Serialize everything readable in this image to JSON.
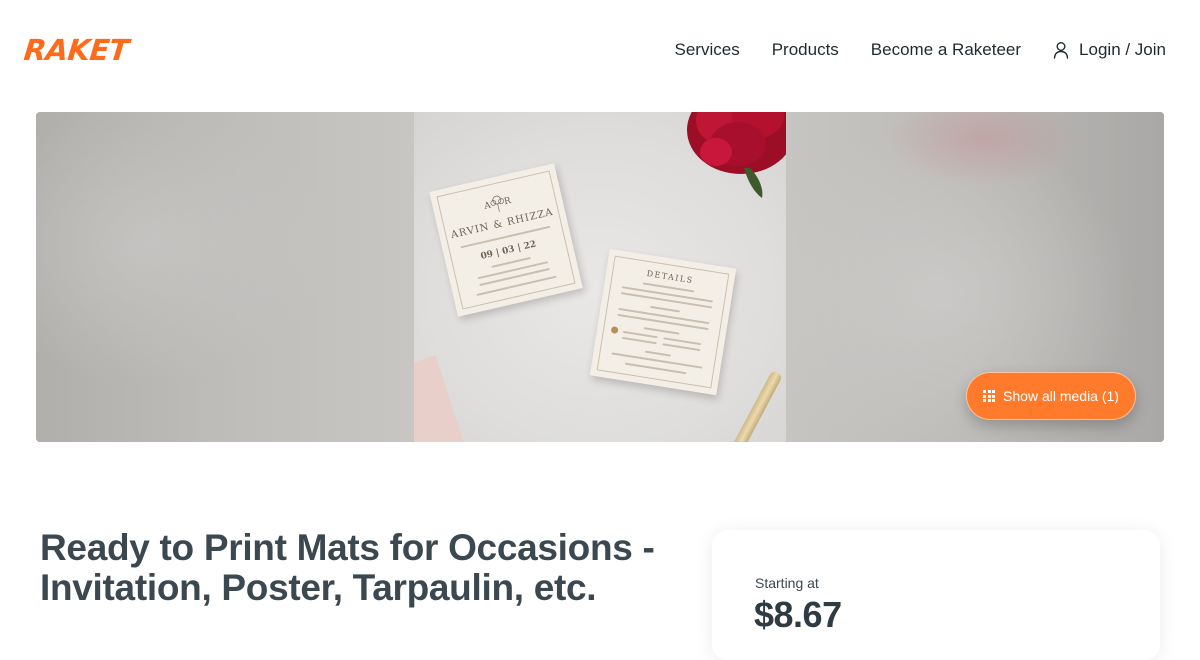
{
  "brand": {
    "logo_text": "RAKET",
    "accent_color": "#ff6b1a"
  },
  "nav": {
    "items": [
      {
        "label": "Services"
      },
      {
        "label": "Products"
      },
      {
        "label": "Become a Raketeer"
      }
    ],
    "login_label": "Login / Join",
    "login_icon": "user-icon"
  },
  "gallery": {
    "show_media_label": "Show all media (1)",
    "show_media_icon": "grid-icon",
    "button_color": "#ff7a2a",
    "photo": {
      "card1": {
        "monogram_left": "A",
        "monogram_right": "R",
        "names": "ARVIN & RHIZZA",
        "date": "09 | 03 | 22"
      },
      "card2": {
        "heading": "DETAILS"
      }
    }
  },
  "listing": {
    "title": "Ready to Print Mats for Occasions - Invitation, Poster, Tarpaulin, etc.",
    "starting_label": "Starting at",
    "price": "$8.67"
  }
}
